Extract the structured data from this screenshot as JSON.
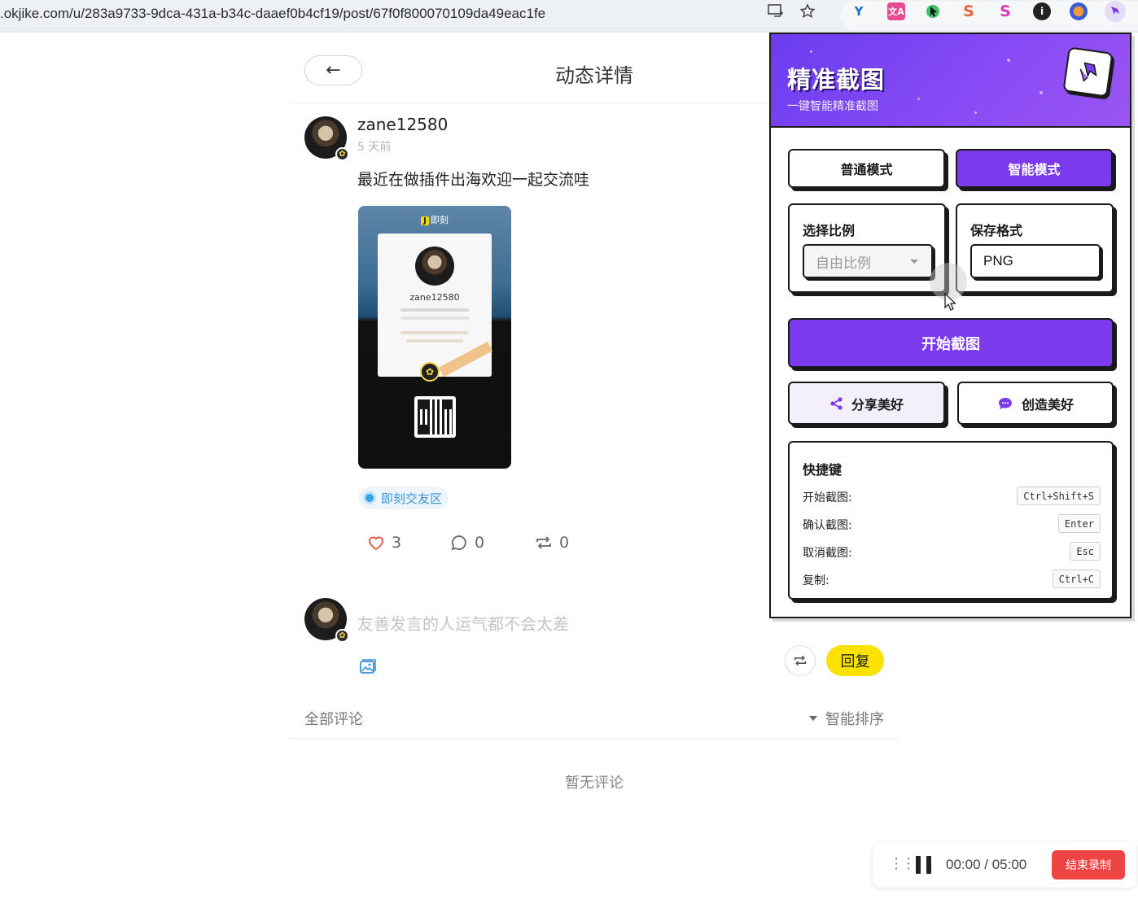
{
  "browser": {
    "url": ".okjike.com/u/283a9733-9dca-431a-b34c-daaef0b4cf19/post/67f0f800070109da49eac1fe"
  },
  "header": {
    "back_label": "←",
    "title": "动态详情"
  },
  "post": {
    "username": "zane12580",
    "time": "5 天前",
    "text": "最近在做插件出海欢迎一起交流哇",
    "image": {
      "logo": "即刻",
      "name": "zane12580"
    },
    "tag": "即刻交友区",
    "likes": "3",
    "comments": "0",
    "reposts": "0"
  },
  "comment_box": {
    "placeholder": "友善发言的人运气都不会太差",
    "reply_label": "回复"
  },
  "comments": {
    "all_label": "全部评论",
    "sort_label": "智能排序",
    "empty_label": "暂无评论"
  },
  "popup": {
    "title": "精准截图",
    "subtitle": "一键智能精准截图",
    "mode_normal": "普通模式",
    "mode_smart": "智能模式",
    "ratio_label": "选择比例",
    "ratio_value": "自由比例",
    "format_label": "保存格式",
    "format_value": "PNG",
    "start_label": "开始截图",
    "share_label": "分享美好",
    "create_label": "创造美好",
    "shortcuts_title": "快捷键",
    "shortcuts": [
      {
        "label": "开始截图:",
        "key": "Ctrl+Shift+S"
      },
      {
        "label": "确认截图:",
        "key": "Enter"
      },
      {
        "label": "取消截图:",
        "key": "Esc"
      },
      {
        "label": "复制:",
        "key": "Ctrl+C"
      }
    ],
    "accent": "#7c3aed"
  },
  "recorder": {
    "time": "00:00  /  05:00",
    "stop_label": "结束录制"
  }
}
